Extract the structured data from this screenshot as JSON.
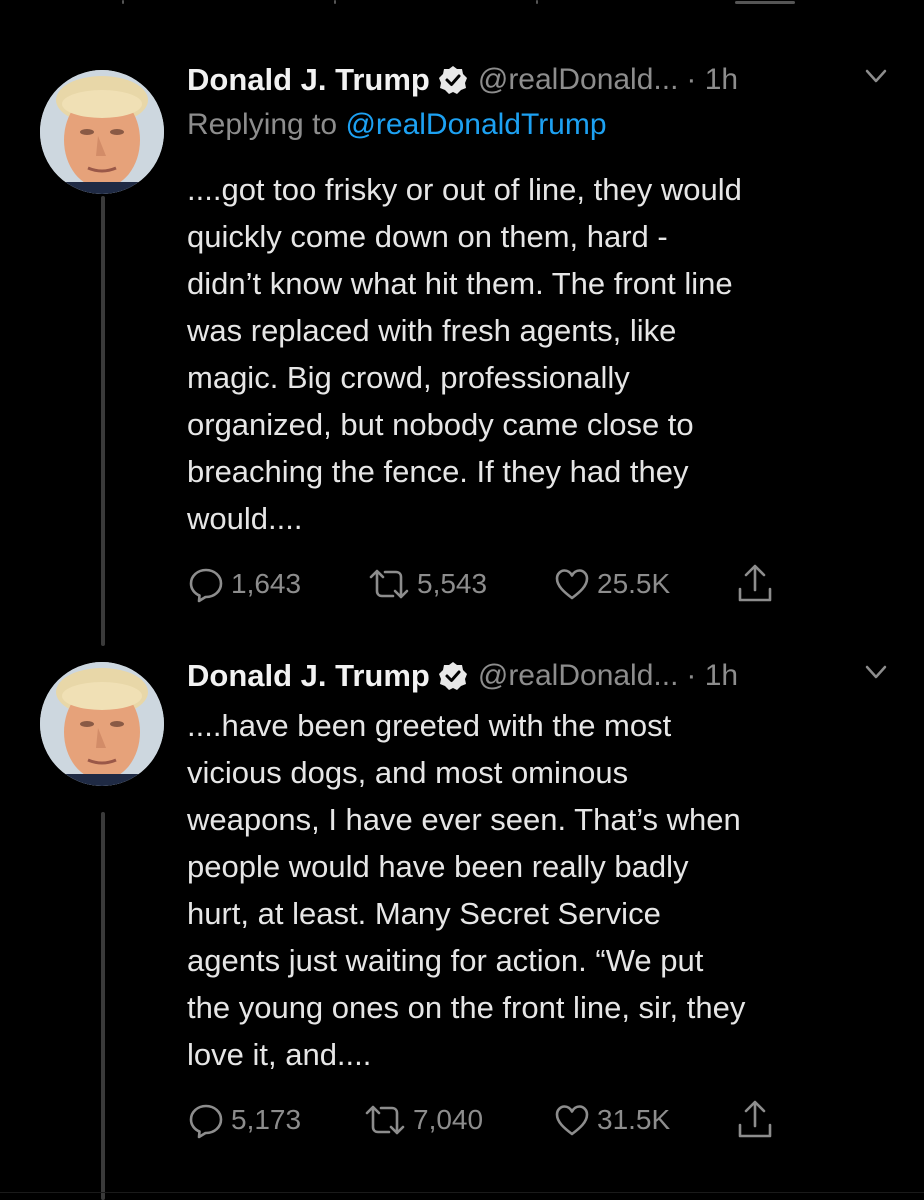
{
  "colors": {
    "background": "#000000",
    "text": "#e6e6e6",
    "muted": "#8d8d8d",
    "link": "#1da1f2",
    "thread_line": "#3a3a3a"
  },
  "tweets": [
    {
      "name": "Donald J. Trump",
      "handle": "@realDonald...",
      "time": "· 1h",
      "replying_label": "Replying to",
      "replying_handle": "@realDonaldTrump",
      "text": "....got too frisky or out of line, they would\nquickly come down on them, hard -\ndidn’t know what hit them. The front line\nwas replaced with fresh agents, like\nmagic. Big crowd, professionally\norganized, but nobody came close to\nbreaching the fence. If they had they\nwould....",
      "replies": "1,643",
      "retweets": "5,543",
      "likes": "25.5K",
      "icons": [
        "verified-icon",
        "chevron-down-icon",
        "reply-icon",
        "retweet-icon",
        "like-icon",
        "share-icon"
      ]
    },
    {
      "name": "Donald J. Trump",
      "handle": "@realDonald...",
      "time": "· 1h",
      "text": "....have been greeted with the most\nvicious dogs, and most ominous\nweapons, I have ever seen. That’s when\npeople would have been really badly\nhurt, at least. Many Secret Service\nagents just waiting for action. “We put\nthe young ones on the front line, sir, they\nlove it, and....",
      "replies": "5,173",
      "retweets": "7,040",
      "likes": "31.5K",
      "icons": [
        "verified-icon",
        "chevron-down-icon",
        "reply-icon",
        "retweet-icon",
        "like-icon",
        "share-icon"
      ]
    }
  ]
}
